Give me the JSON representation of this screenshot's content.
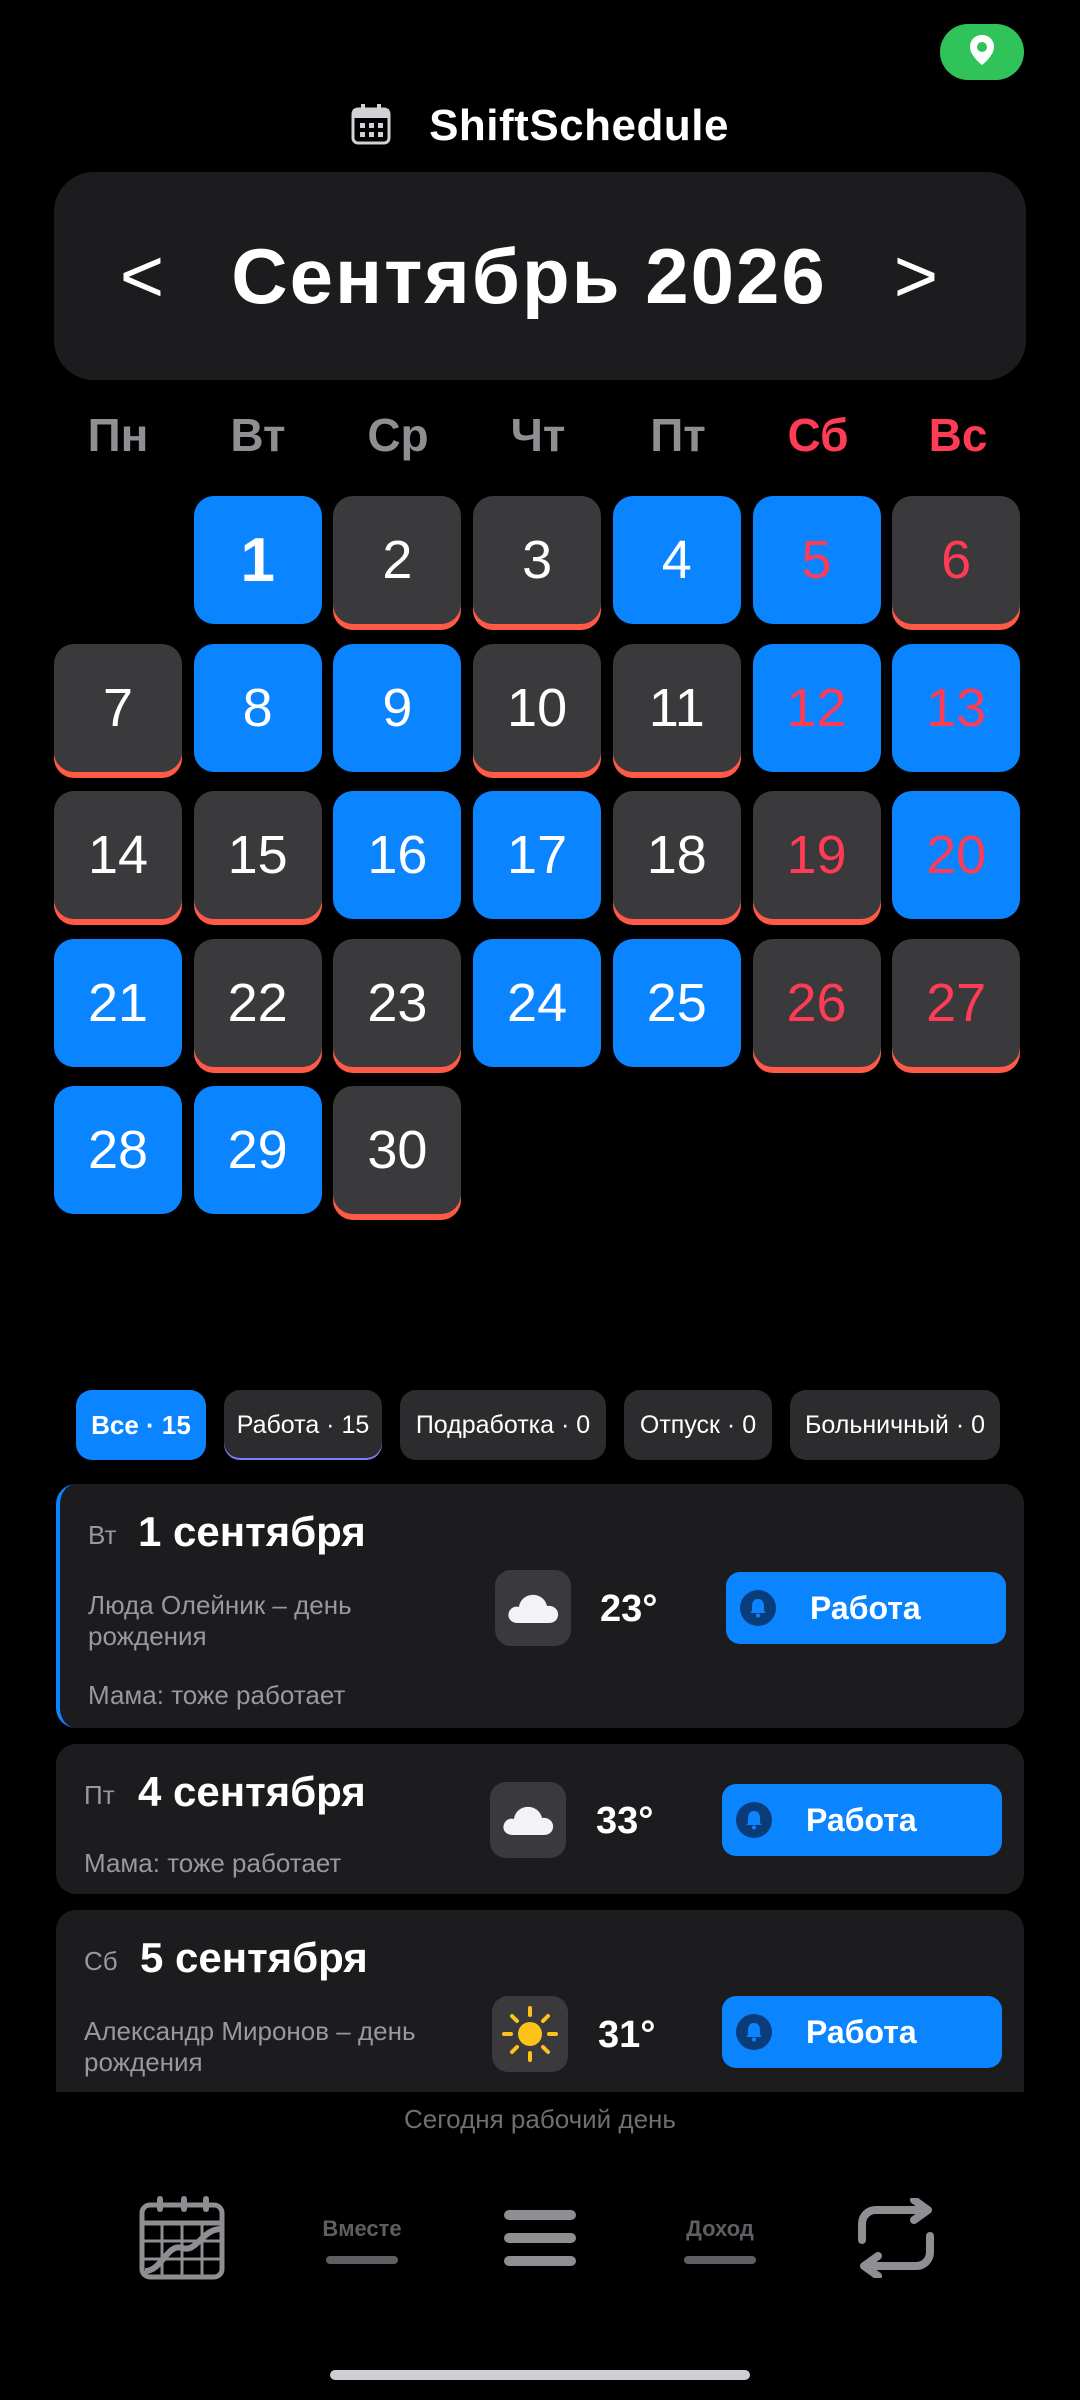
{
  "app": {
    "name": "ShiftSchedule",
    "location_icon": "map-pin-icon",
    "title_icon": "calendar-icon"
  },
  "month": {
    "label": "Сентябрь 2026",
    "prev": "<",
    "next": ">"
  },
  "weekdays": [
    "Пн",
    "Вт",
    "Ср",
    "Чт",
    "Пт",
    "Сб",
    "Вс"
  ],
  "calendar": {
    "days": [
      {
        "n": "1",
        "type": "work",
        "today": true
      },
      {
        "n": "2",
        "type": "off"
      },
      {
        "n": "3",
        "type": "off"
      },
      {
        "n": "4",
        "type": "work"
      },
      {
        "n": "5",
        "type": "work",
        "weekend": true
      },
      {
        "n": "6",
        "type": "off",
        "weekend": true
      },
      {
        "n": "7",
        "type": "off"
      },
      {
        "n": "8",
        "type": "work"
      },
      {
        "n": "9",
        "type": "work"
      },
      {
        "n": "10",
        "type": "off"
      },
      {
        "n": "11",
        "type": "off"
      },
      {
        "n": "12",
        "type": "work",
        "weekend": true
      },
      {
        "n": "13",
        "type": "work",
        "weekend": true
      },
      {
        "n": "14",
        "type": "off"
      },
      {
        "n": "15",
        "type": "off"
      },
      {
        "n": "16",
        "type": "work"
      },
      {
        "n": "17",
        "type": "work"
      },
      {
        "n": "18",
        "type": "off"
      },
      {
        "n": "19",
        "type": "off",
        "weekend": true
      },
      {
        "n": "20",
        "type": "work",
        "weekend": true
      },
      {
        "n": "21",
        "type": "work"
      },
      {
        "n": "22",
        "type": "off"
      },
      {
        "n": "23",
        "type": "off"
      },
      {
        "n": "24",
        "type": "work"
      },
      {
        "n": "25",
        "type": "work"
      },
      {
        "n": "26",
        "type": "off",
        "weekend": true
      },
      {
        "n": "27",
        "type": "off",
        "weekend": true
      },
      {
        "n": "28",
        "type": "work"
      },
      {
        "n": "29",
        "type": "work"
      },
      {
        "n": "30",
        "type": "off"
      }
    ]
  },
  "filters": [
    {
      "label": "Все · 15",
      "active": true
    },
    {
      "label": "Работа · 15",
      "active": false
    },
    {
      "label": "Подработка · 0",
      "active": false
    },
    {
      "label": "Отпуск · 0",
      "active": false
    },
    {
      "label": "Больничный · 0",
      "active": false
    }
  ],
  "shifts": [
    {
      "dow": "Вт",
      "date": "1 сентября",
      "note1": "Люда  Олейник – день рождения",
      "note2": "Мама: тоже работает",
      "weather_icon": "cloud-icon",
      "temp": "23°",
      "shift": "Работа"
    },
    {
      "dow": "Пт",
      "date": "4 сентября",
      "note1": "Мама: тоже работает",
      "weather_icon": "cloud-icon",
      "temp": "33°",
      "shift": "Работа"
    },
    {
      "dow": "Сб",
      "date": "5 сентября",
      "note1": "Александр Миронов – день рождения",
      "weather_icon": "sun-icon",
      "temp": "31°",
      "shift": "Работа"
    }
  ],
  "status": "Сегодня рабочий день",
  "bottom_nav": {
    "together": "Вместе",
    "income": "Доход"
  },
  "colors": {
    "work": "#0a84ff",
    "off": "#3a3a3c",
    "off_underline": "#ff5a45",
    "weekend_text": "#ff3b55",
    "location": "#30c35a"
  }
}
